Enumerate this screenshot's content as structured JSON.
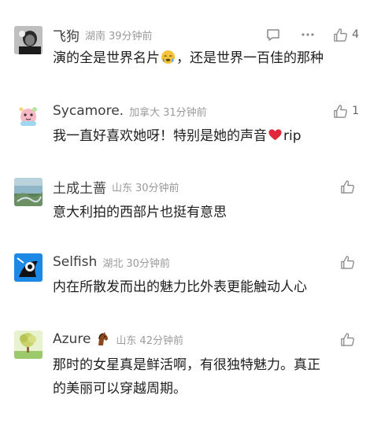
{
  "icons": {
    "reply": "speech-bubble-icon",
    "more": "ellipsis-icon",
    "like": "thumbs-up-icon"
  },
  "colors": {
    "name": "#3d3d3d",
    "meta": "#9a9a9a",
    "text": "#1e1e1e",
    "icon": "#9a9a9a"
  },
  "comments": [
    {
      "name": "飞狗",
      "region": "湖南",
      "time": "39分钟前",
      "text_before": "演的全是世界名片",
      "emoji": "crying-face-emoji",
      "text_after": "，还是世界一百佳的那种",
      "like_count": "4"
    },
    {
      "name": "Sycamore.",
      "region": "加拿大",
      "time": "31分钟前",
      "text_before": "我一直好喜欢她呀！特别是她的声音",
      "emoji": "red-heart-emoji",
      "text_after": "rip",
      "like_count": "1"
    },
    {
      "name": "土成土蔷",
      "region": "山东",
      "time": "30分钟前",
      "text": "意大利拍的西部片也挺有意思",
      "like_count": ""
    },
    {
      "name": "Selfish",
      "region": "湖北",
      "time": "30分钟前",
      "text": "内在所散发而出的魅力比外表更能触动人心",
      "like_count": ""
    },
    {
      "name": "Azure",
      "name_badge": "horse-emoji",
      "region": "山东",
      "time": "42分钟前",
      "text_line1": "那时的女星真是鲜活啊，有很独特魅力。真正",
      "text_line2": "的美丽可以穿越周期。",
      "like_count": ""
    }
  ]
}
